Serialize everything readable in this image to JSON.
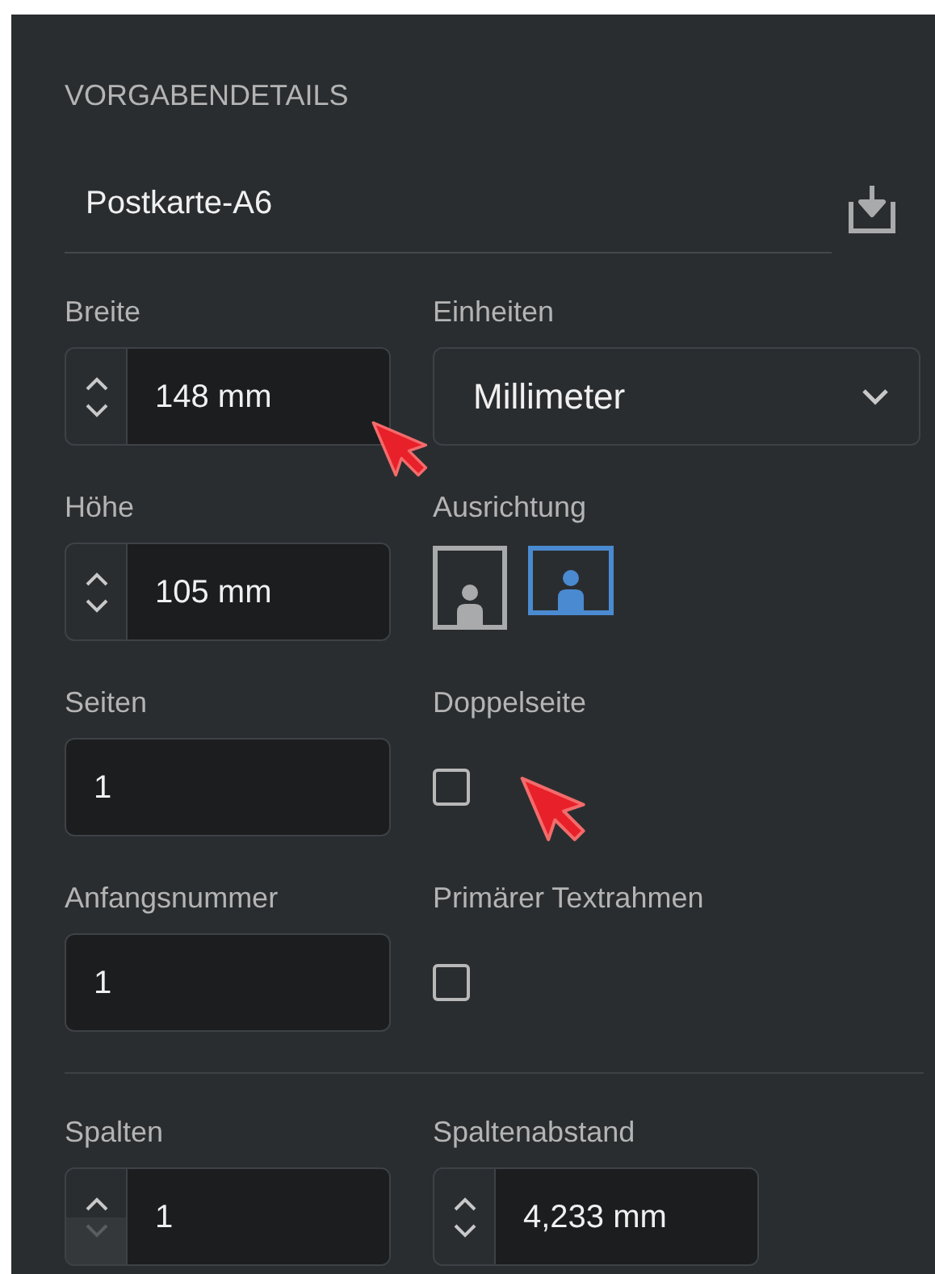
{
  "section_title": "VORGABENDETAILS",
  "preset_name": "Postkarte-A6",
  "rows": [
    {
      "left": {
        "label": "Breite",
        "kind": "spinner",
        "value": "148 mm",
        "down_disabled": false
      },
      "right": {
        "label": "Einheiten",
        "kind": "dropdown",
        "value": "Millimeter"
      }
    },
    {
      "left": {
        "label": "Höhe",
        "kind": "spinner",
        "value": "105 mm",
        "down_disabled": false
      },
      "right": {
        "label": "Ausrichtung",
        "kind": "orientation",
        "options": [
          {
            "kind": "portrait",
            "selected": false
          },
          {
            "kind": "landscape",
            "selected": true
          }
        ]
      }
    },
    {
      "left": {
        "label": "Seiten",
        "kind": "text",
        "value": "1"
      },
      "right": {
        "label": "Doppelseite",
        "kind": "checkbox",
        "checked": false
      }
    },
    {
      "left": {
        "label": "Anfangsnummer",
        "kind": "text",
        "value": "1"
      },
      "right": {
        "label": "Primärer Textrahmen",
        "kind": "checkbox",
        "checked": false
      }
    },
    {
      "divider": true,
      "left": {
        "label": "Spalten",
        "kind": "spinner",
        "value": "1",
        "down_disabled": true
      },
      "right": {
        "label": "Spaltenabstand",
        "kind": "spinner",
        "value": "4,233 mm",
        "down_disabled": false
      }
    }
  ]
}
